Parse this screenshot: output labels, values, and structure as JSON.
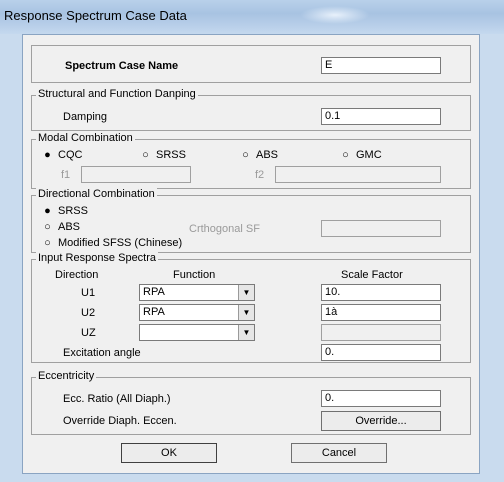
{
  "window": {
    "title": "Response Spectrum Case Data"
  },
  "name": {
    "label": "Spectrum Case Name",
    "value": "E"
  },
  "damping": {
    "legend": "Structural and Function Danping",
    "label": "Damping",
    "value": "0.1"
  },
  "modal": {
    "legend": "Modal Combination",
    "options": [
      "CQC",
      "SRSS",
      "ABS",
      "GMC"
    ],
    "selected": "CQC",
    "f1_label": "f1",
    "f2_label": "f2",
    "selected_glyph": "●",
    "unselected_glyph": "○"
  },
  "directional": {
    "legend": "Directional Combination",
    "options": [
      "SRSS",
      "ABS",
      "Modified SFSS (Chinese)"
    ],
    "selected": "SRSS",
    "orth_label": "Crthogonal SF"
  },
  "spectra": {
    "legend": "Input Response Spectra",
    "col_direction": "Direction",
    "col_function": "Function",
    "col_scale": "Scale Factor",
    "rows": [
      {
        "direction": "U1",
        "function": "RPA",
        "scale": "10."
      },
      {
        "direction": "U2",
        "function": "RPA",
        "scale": "1à"
      },
      {
        "direction": "UZ",
        "function": "",
        "scale": ""
      }
    ],
    "excitation_label": "Excitation angle",
    "excitation_value": "0."
  },
  "eccentricity": {
    "legend": "Eccentricity",
    "ratio_label": "Ecc. Ratio (All Diaph.)",
    "ratio_value": "0.",
    "override_label": "Override Diaph. Eccen.",
    "override_button": "Override..."
  },
  "buttons": {
    "ok": "OK",
    "cancel": "Cancel"
  },
  "icons": {
    "dropdown": "chevron-down-icon"
  }
}
